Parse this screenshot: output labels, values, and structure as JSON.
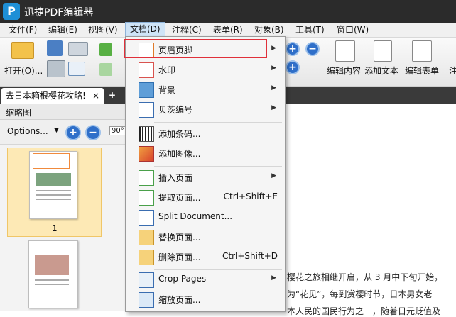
{
  "window": {
    "title": "迅捷PDF编辑器",
    "logo_letter": "P"
  },
  "menubar": [
    "文件(F)",
    "编辑(E)",
    "视图(V)",
    "文档(D)",
    "注释(C)",
    "表单(R)",
    "对象(B)",
    "工具(T)",
    "窗口(W)"
  ],
  "toolbar": {
    "open_label": "打开(O)...",
    "edit_content": "编辑内容",
    "add_text": "添加文本",
    "edit_form": "编辑表单",
    "partial_label": "注"
  },
  "tab": {
    "label": "去日本箱根樱花攻略!",
    "close": "×",
    "new": "+"
  },
  "panel": {
    "title": "缩略图",
    "options": "Options...",
    "rotate": "90°",
    "page1": "1"
  },
  "document": {
    "line1": "樱花之旅相继开启，从 3 月中下旬开始，",
    "line2": "为“花见”，每到赏樱时节，日本男女老",
    "line3": "本人民的国民行为之一，随着日元贬值及"
  },
  "dropdown": {
    "items": [
      {
        "label": "页眉页脚",
        "icon": "header-footer-icon",
        "submenu": true
      },
      {
        "label": "水印",
        "icon": "watermark-icon",
        "submenu": true
      },
      {
        "label": "背景",
        "icon": "background-icon",
        "submenu": true
      },
      {
        "label": "贝茨编号",
        "icon": "bates-number-icon",
        "submenu": true
      },
      {
        "label": "添加条码...",
        "icon": "barcode-icon"
      },
      {
        "label": "添加图像...",
        "icon": "add-image-icon"
      },
      {
        "label": "插入页面",
        "icon": "insert-page-icon",
        "submenu": true
      },
      {
        "label": "提取页面...",
        "icon": "extract-page-icon",
        "shortcut": "Ctrl+Shift+E"
      },
      {
        "label": "Split Document...",
        "icon": "split-document-icon"
      },
      {
        "label": "替换页面...",
        "icon": "replace-page-icon"
      },
      {
        "label": "删除页面...",
        "icon": "delete-page-icon",
        "shortcut": "Ctrl+Shift+D"
      },
      {
        "label": "Crop Pages",
        "icon": "crop-pages-icon",
        "submenu": true
      },
      {
        "label": "缩放页面...",
        "icon": "resize-page-icon"
      }
    ],
    "arrow": "▶"
  },
  "colors": {
    "accent": "#2f6fc9",
    "highlight": "#e0303a",
    "selection": "#fde9b5"
  }
}
